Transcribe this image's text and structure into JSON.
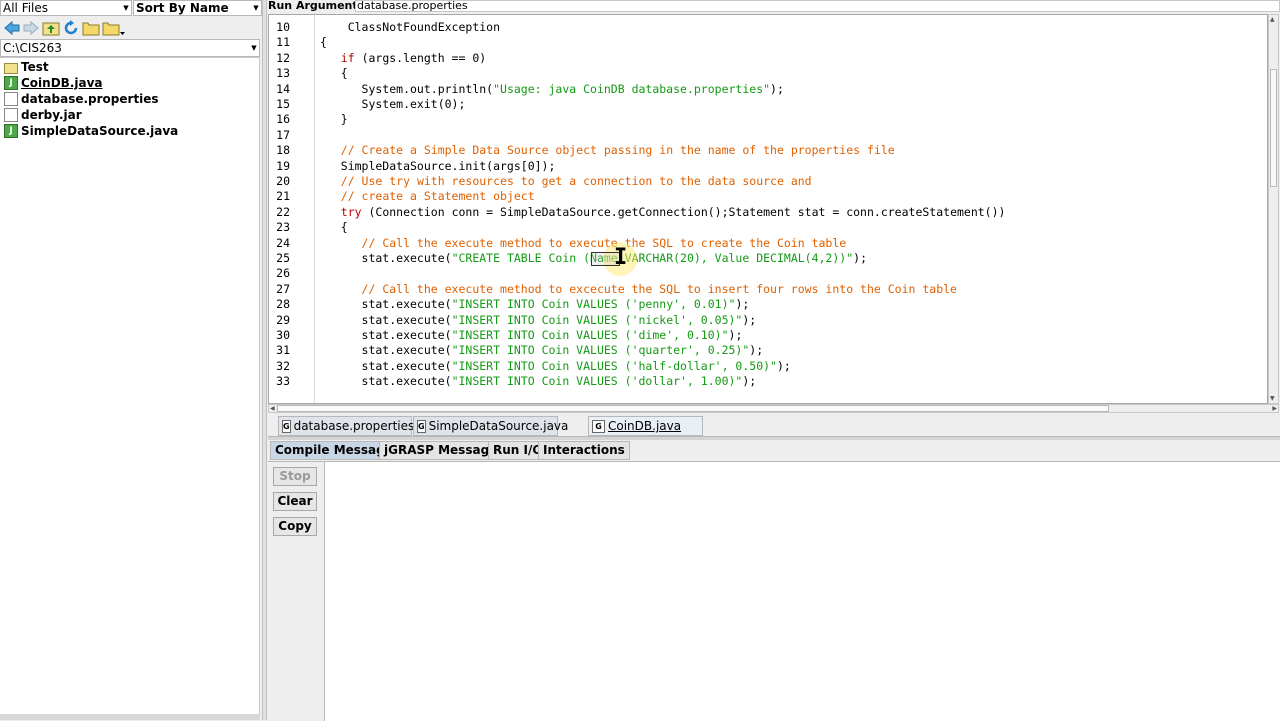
{
  "browser": {
    "filter": "All Files",
    "sort": "Sort By Name",
    "path": "C:\\CIS263",
    "files": [
      {
        "name": "Test",
        "icon": "folder-icon"
      },
      {
        "name": "CoinDB.java",
        "icon": "java-file-icon"
      },
      {
        "name": "database.properties",
        "icon": "document-icon"
      },
      {
        "name": "derby.jar",
        "icon": "document-icon"
      },
      {
        "name": "SimpleDataSource.java",
        "icon": "java-file-icon"
      }
    ]
  },
  "run_args": {
    "label": "Run Arguments",
    "value": "database.properties"
  },
  "editor": {
    "lines": [
      {
        "n": "10",
        "text": "    ClassNotFoundException"
      },
      {
        "n": "11",
        "text": "{"
      },
      {
        "n": "12",
        "text": "   if (args.length == 0)"
      },
      {
        "n": "13",
        "text": "   {"
      },
      {
        "n": "14",
        "text": "      System.out.println(\"Usage: java CoinDB database.properties\");"
      },
      {
        "n": "15",
        "text": "      System.exit(0);"
      },
      {
        "n": "16",
        "text": "   }"
      },
      {
        "n": "17",
        "text": ""
      },
      {
        "n": "18",
        "text": "   // Create a Simple Data Source object passing in the name of the properties file"
      },
      {
        "n": "19",
        "text": "   SimpleDataSource.init(args[0]);"
      },
      {
        "n": "20",
        "text": "   // Use try with resources to get a connection to the data source and"
      },
      {
        "n": "21",
        "text": "   // create a Statement object"
      },
      {
        "n": "22",
        "text": "   try (Connection conn = SimpleDataSource.getConnection();Statement stat = conn.createStatement())"
      },
      {
        "n": "23",
        "text": "   {"
      },
      {
        "n": "24",
        "text": "      // Call the execute method to execute the SQL to create the Coin table"
      },
      {
        "n": "25",
        "text": "      stat.execute(\"CREATE TABLE Coin (Name VARCHAR(20), Value DECIMAL(4,2))\");"
      },
      {
        "n": "26",
        "text": ""
      },
      {
        "n": "27",
        "text": "      // Call the execute method to excecute the SQL to insert four rows into the Coin table"
      },
      {
        "n": "28",
        "text": "      stat.execute(\"INSERT INTO Coin VALUES ('penny', 0.01)\");"
      },
      {
        "n": "29",
        "text": "      stat.execute(\"INSERT INTO Coin VALUES ('nickel', 0.05)\");"
      },
      {
        "n": "30",
        "text": "      stat.execute(\"INSERT INTO Coin VALUES ('dime', 0.10)\");"
      },
      {
        "n": "31",
        "text": "      stat.execute(\"INSERT INTO Coin VALUES ('quarter', 0.25)\");"
      },
      {
        "n": "32",
        "text": "      stat.execute(\"INSERT INTO Coin VALUES ('half-dollar', 0.50)\");"
      },
      {
        "n": "33",
        "text": "      stat.execute(\"INSERT INTO Coin VALUES ('dollar', 1.00)\");"
      }
    ]
  },
  "doc_tabs": [
    {
      "label": "database.properties",
      "active": false
    },
    {
      "label": "SimpleDataSource.java",
      "active": false
    },
    {
      "label": "CoinDB.java",
      "active": true
    }
  ],
  "msg_tabs": [
    {
      "label": "Compile Messages",
      "active": true
    },
    {
      "label": "jGRASP Messages",
      "active": false
    },
    {
      "label": "Run I/O",
      "active": false
    },
    {
      "label": "Interactions",
      "active": false
    }
  ],
  "side_buttons": {
    "stop": "Stop",
    "clear": "Clear",
    "copy": "Copy"
  },
  "icon_glyphs": {
    "java": "J",
    "gfile": "G"
  },
  "colors": {
    "keyword": "#b40000",
    "string": "#149a14",
    "comment": "#e06000"
  }
}
